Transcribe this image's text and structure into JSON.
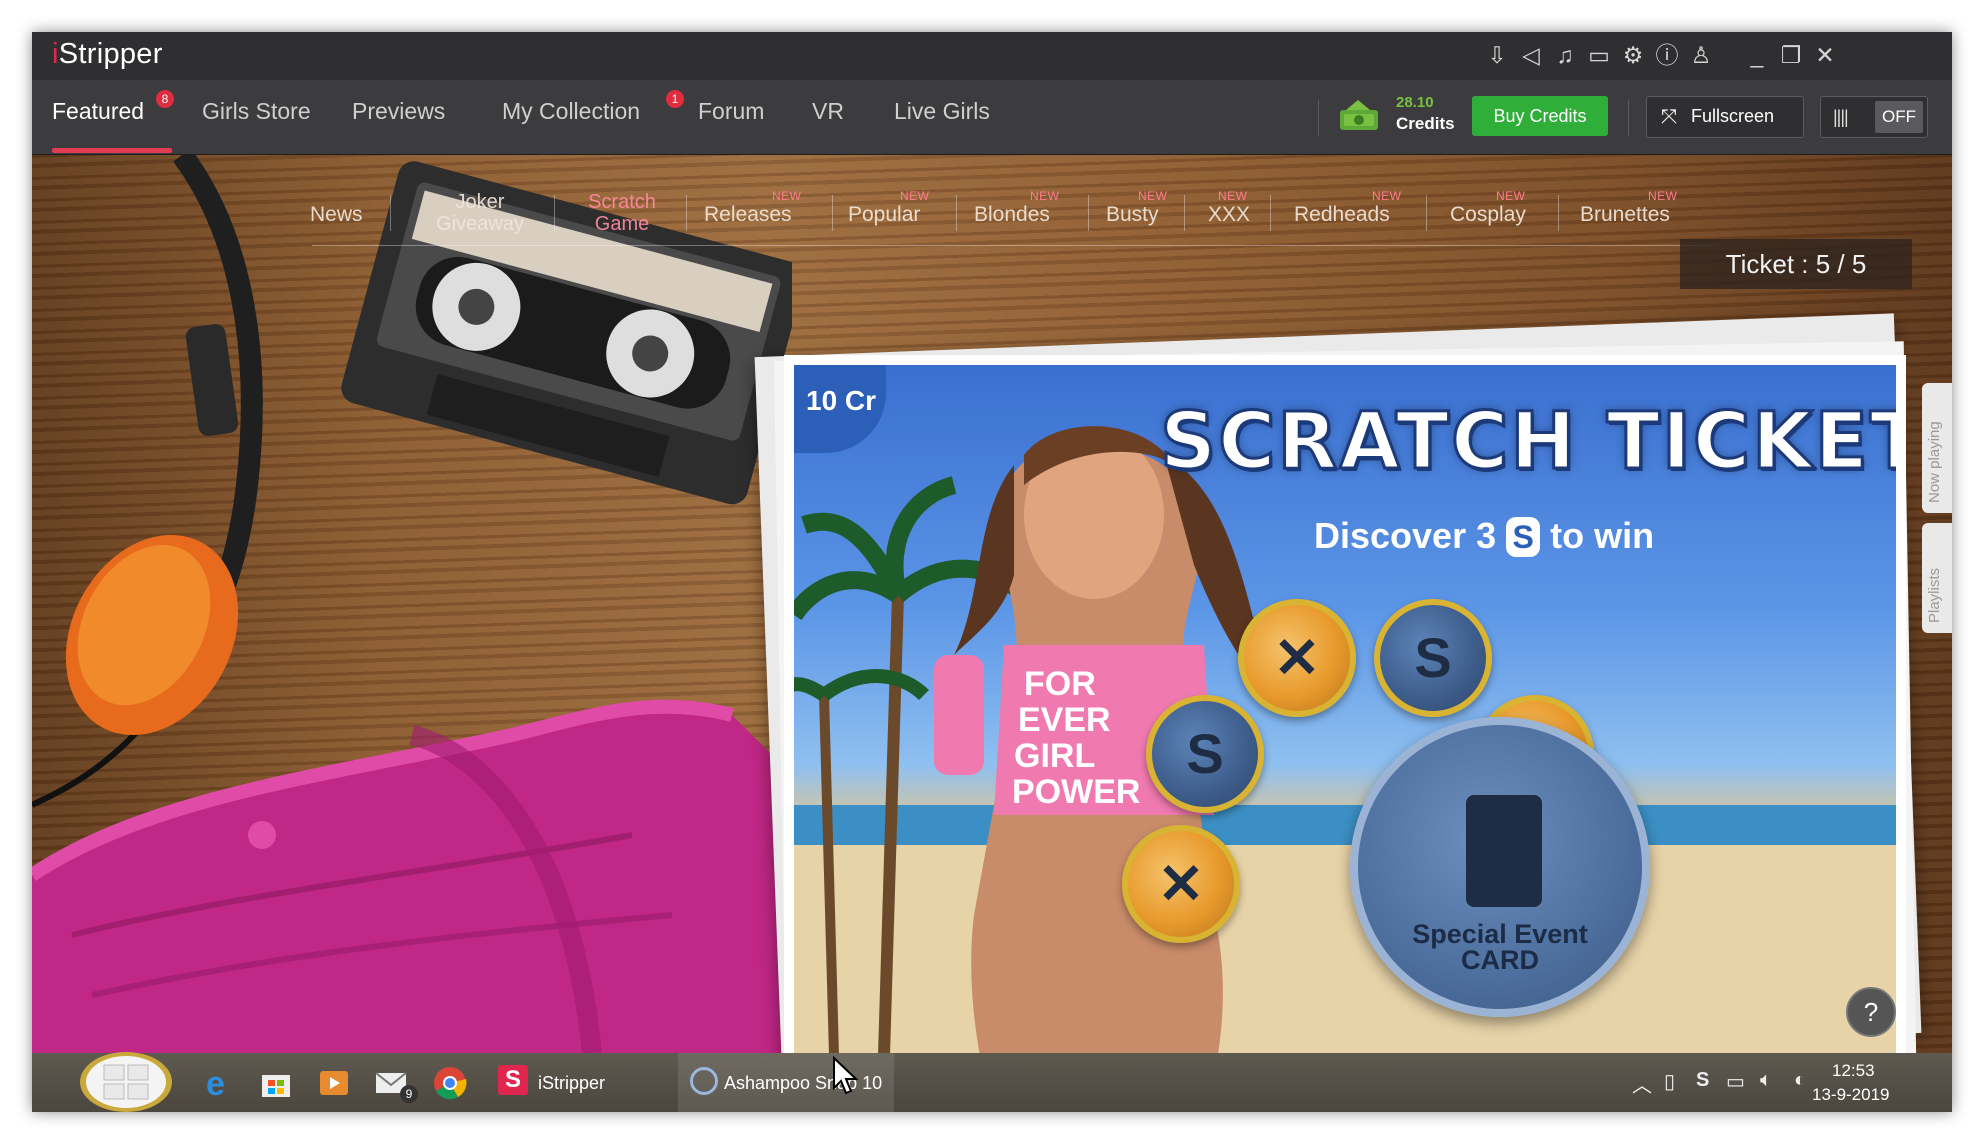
{
  "app": {
    "title_prefix": "i",
    "title_rest": "Stripper"
  },
  "nav": {
    "items": [
      {
        "label": "Featured",
        "badge": "8"
      },
      {
        "label": "Girls Store"
      },
      {
        "label": "Previews"
      },
      {
        "label": "My Collection",
        "badge": "1"
      },
      {
        "label": "Forum"
      },
      {
        "label": "VR"
      },
      {
        "label": "Live Girls"
      }
    ],
    "credits_amount": "28.10",
    "credits_label": "Credits",
    "buy_credits": "Buy Credits",
    "fullscreen": "Fullscreen",
    "toggle_state": "OFF"
  },
  "subnav": {
    "items": [
      {
        "label": "News",
        "new": ""
      },
      {
        "label": "Joker Giveaway",
        "new": ""
      },
      {
        "label": "Scratch Game",
        "new": ""
      },
      {
        "label": "Releases",
        "new": "NEW"
      },
      {
        "label": "Popular",
        "new": "NEW"
      },
      {
        "label": "Blondes",
        "new": "NEW"
      },
      {
        "label": "Busty",
        "new": "NEW"
      },
      {
        "label": "XXX",
        "new": "NEW"
      },
      {
        "label": "Redheads",
        "new": "NEW"
      },
      {
        "label": "Cosplay",
        "new": "NEW"
      },
      {
        "label": "Brunettes",
        "new": "NEW"
      }
    ]
  },
  "ticket": {
    "counter": "Ticket : 5 / 5",
    "price": "10 Cr",
    "title": "SCRATCH TICKET",
    "subtitle_before": "Discover 3",
    "subtitle_symbol": "S",
    "subtitle_after": "to win",
    "special_label_1": "Special Event",
    "special_label_2": "CARD",
    "help": "?"
  },
  "side_tabs": {
    "now_playing": "Now playing",
    "playlists": "Playlists"
  },
  "taskbar": {
    "mail_badge": "9",
    "istripper": "iStripper",
    "snap": "Ashampoo Snap 10",
    "time": "12:53",
    "date": "13-9-2019"
  },
  "colors": {
    "accent": "#e23c54",
    "buy": "#2fae3a",
    "ticket_blue": "#3a6fd0"
  }
}
